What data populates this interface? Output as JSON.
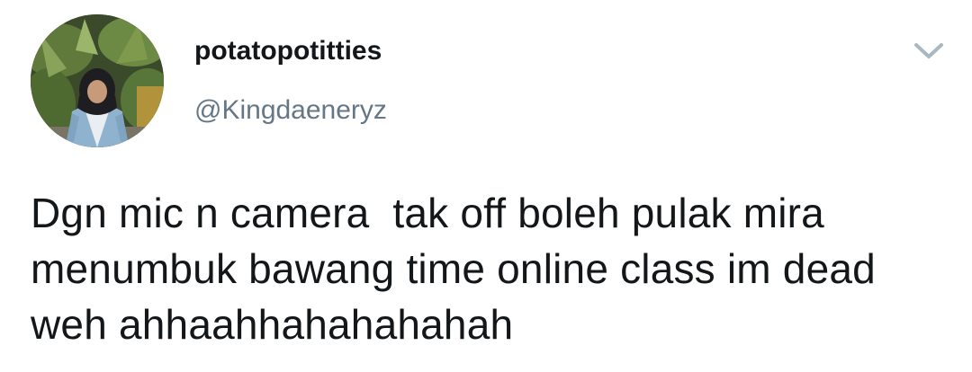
{
  "tweet": {
    "display_name": "potatopotitties",
    "handle": "@Kingdaeneryz",
    "text": "Dgn mic n camera  tak off boleh pulak mira menumbuk bawang time online class im dead weh ahhaahhahahahahah"
  },
  "icons": {
    "avatar": "user-avatar-photo",
    "menu": "chevron-down-icon"
  },
  "colors": {
    "text": "#14171a",
    "secondary_text": "#657786",
    "caret": "#aab8c2"
  }
}
